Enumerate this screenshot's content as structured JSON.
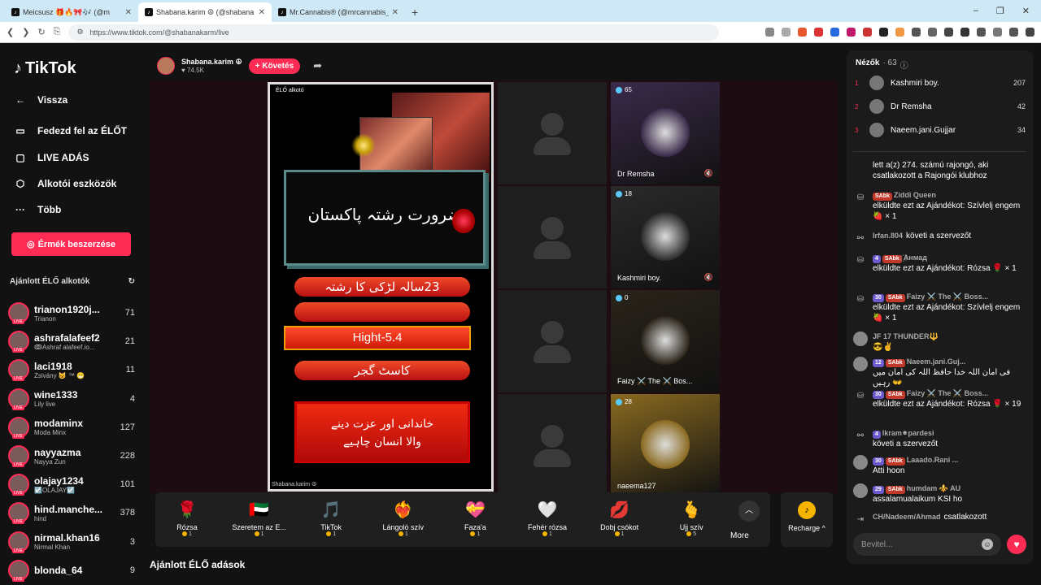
{
  "browser": {
    "tabs": [
      {
        "label": "Meicsusz 🎁🔥🎀🎶 (@m",
        "icon": "tiktok-icon"
      },
      {
        "label": "Shabana.karim ☮ (@shabana",
        "icon": "tiktok-icon"
      },
      {
        "label": "Mr.Cannabis® (@mrcannabis_) ÉLŐ",
        "icon": "tiktok-icon"
      }
    ],
    "url": "https://www.tiktok.com/@shabanakarm/live"
  },
  "sidebar": {
    "logo": "TikTok",
    "nav": [
      {
        "label": "Vissza",
        "icon": "back-arrow-icon"
      },
      {
        "label": "Fedezd fel az ÉLŐT",
        "icon": "explore-live-icon"
      },
      {
        "label": "LIVE ADÁS",
        "icon": "live-icon"
      },
      {
        "label": "Alkotói eszközök",
        "icon": "tools-icon"
      },
      {
        "label": "Több",
        "icon": "more-icon"
      }
    ],
    "coins_button": "Érmék beszerzése",
    "recommended_header": "Ajánlott ÉLŐ alkotók",
    "creators": [
      {
        "name": "trianon1920j...",
        "sub": "Trianon",
        "count": "71"
      },
      {
        "name": "ashrafalafeef2",
        "sub": "ↂAshraf alafeef.io...",
        "count": "21"
      },
      {
        "name": "laci1918",
        "sub": "Zsivány 😺 ™ 😁",
        "count": "11"
      },
      {
        "name": "wine1333",
        "sub": "Lily live",
        "count": "4"
      },
      {
        "name": "modaminx",
        "sub": "Moda Minx",
        "count": "127"
      },
      {
        "name": "nayyazma",
        "sub": "Nayya Zun",
        "count": "228"
      },
      {
        "name": "olajay1234",
        "sub": "☑️OLAJAY☑️",
        "count": "101"
      },
      {
        "name": "hind.manche...",
        "sub": "hind",
        "count": "378"
      },
      {
        "name": "nirmal.khan16",
        "sub": "Nirmal Khan",
        "count": "3"
      },
      {
        "name": "blonda_64",
        "sub": "",
        "count": "9"
      }
    ],
    "live_badge": "LIVE"
  },
  "host": {
    "name": "Shabana.karim ☮",
    "likes": "74.5K",
    "follow_label": "+ Követés"
  },
  "stream": {
    "live_tag": "ÉLŐ alkotó",
    "host_label": "Shabana.karim ☮",
    "overlay_title": "ضرورت رشتہ  پاکستان",
    "age_line": "23سالہ  لڑکی   کا رشتہ",
    "height_line": "Hight-5.4",
    "caste_line": "کاسٹ گجر",
    "family_line1": "خاندانی اور عزت دینے",
    "family_line2": "والا انسان چاہیے"
  },
  "guests": [
    {
      "name": "Dr Remsha",
      "count": "65",
      "color": "#3a2a4a"
    },
    {
      "name": "Kashmiri boy.",
      "count": "18",
      "color": "#2a2a2a"
    },
    {
      "name": "Faizy ⚔️ The ⚔️ Bos...",
      "count": "0",
      "color": "#2a241a"
    },
    {
      "name": "naeema127",
      "count": "28",
      "color": "#8a6a20"
    }
  ],
  "gifts": [
    {
      "label": "Rózsa",
      "price": "1",
      "icon": "🌹"
    },
    {
      "label": "Szeretem az E...",
      "price": "1",
      "icon": "🇦🇪"
    },
    {
      "label": "TikTok",
      "price": "1",
      "icon": "🎵"
    },
    {
      "label": "Lángoló szív",
      "price": "1",
      "icon": "❤️‍🔥"
    },
    {
      "label": "Faza'a",
      "price": "1",
      "icon": "💝"
    },
    {
      "label": "Fehér rózsa",
      "price": "1",
      "icon": "🤍"
    },
    {
      "label": "Dobj csókot",
      "price": "1",
      "icon": "💋"
    },
    {
      "label": "Ujj szív",
      "price": "5",
      "icon": "🫰"
    }
  ],
  "gifts_more": "More",
  "recharge": "Recharge",
  "recommended_streams": "Ajánlott ÉLŐ adások",
  "chat": {
    "viewers_label": "Nézők",
    "viewers_count": "· 63",
    "top_viewers": [
      {
        "rank": "1",
        "name": "Kashmiri boy.",
        "score": "207"
      },
      {
        "rank": "2",
        "name": "Dr Remsha",
        "score": "42"
      },
      {
        "rank": "3",
        "name": "Naeem.jani.Gujjar",
        "score": "34"
      }
    ],
    "messages": [
      {
        "icon": "",
        "user": "",
        "badges": [],
        "text": "lett a(z) 274. számú rajongó, aki csatlakozott a Rajongói klubhoz"
      },
      {
        "icon": "gift-icon",
        "user": "Ziddi Queen",
        "badges": [
          "SAbk"
        ],
        "text": "elküldte ezt az Ajándékot: Szívlelj engem 🍓 × 1"
      },
      {
        "icon": "follow-icon",
        "user": "Irfan.804",
        "badges": [],
        "text": "követi a szervezőt"
      },
      {
        "icon": "gift-icon",
        "user": "҈Aнмад",
        "badges": [
          "4",
          "SAbk"
        ],
        "text": "elküldte ezt az Ajándékot: Rózsa 🌹 × 1"
      },
      {
        "icon": "gift-icon",
        "user": "Faizy ⚔️ The ⚔️ Boss...",
        "badges": [
          "30",
          "SAbk"
        ],
        "text": "elküldte ezt az Ajándékot: Szívlelj engem 🍓 × 1"
      },
      {
        "icon": "avatar",
        "user": "JF 17 THUNDER🔱",
        "badges": [],
        "text": "😎✌️"
      },
      {
        "icon": "avatar",
        "user": "Naeem.jani.Guj...",
        "badges": [
          "12",
          "SAbk"
        ],
        "text": "فی امان اللہ خدا حافظ اللہ کی امان میں رہیں 👐"
      },
      {
        "icon": "gift-icon",
        "user": "Faizy ⚔️ The ⚔️ Boss...",
        "badges": [
          "30",
          "SAbk"
        ],
        "text": "elküldte ezt az Ajándékot: Rózsa 🌹 × 19"
      },
      {
        "icon": "follow-icon",
        "user": "Ikram⁕pardesi",
        "badges": [
          "4"
        ],
        "text": "követi a szervezőt"
      },
      {
        "icon": "avatar",
        "user": "Laaado.Rani ...",
        "badges": [
          "30",
          "SAbk"
        ],
        "text": "Atti hoon"
      },
      {
        "icon": "avatar",
        "user": "humdam ⚜️ AU",
        "badges": [
          "29",
          "SAbk"
        ],
        "text": "assalamualaikum KSI ho"
      },
      {
        "icon": "join-icon",
        "user": "CH/Nadeem/Ahmad",
        "badges": [],
        "text": "csatlakozott"
      }
    ],
    "input_placeholder": "Bevitel..."
  }
}
